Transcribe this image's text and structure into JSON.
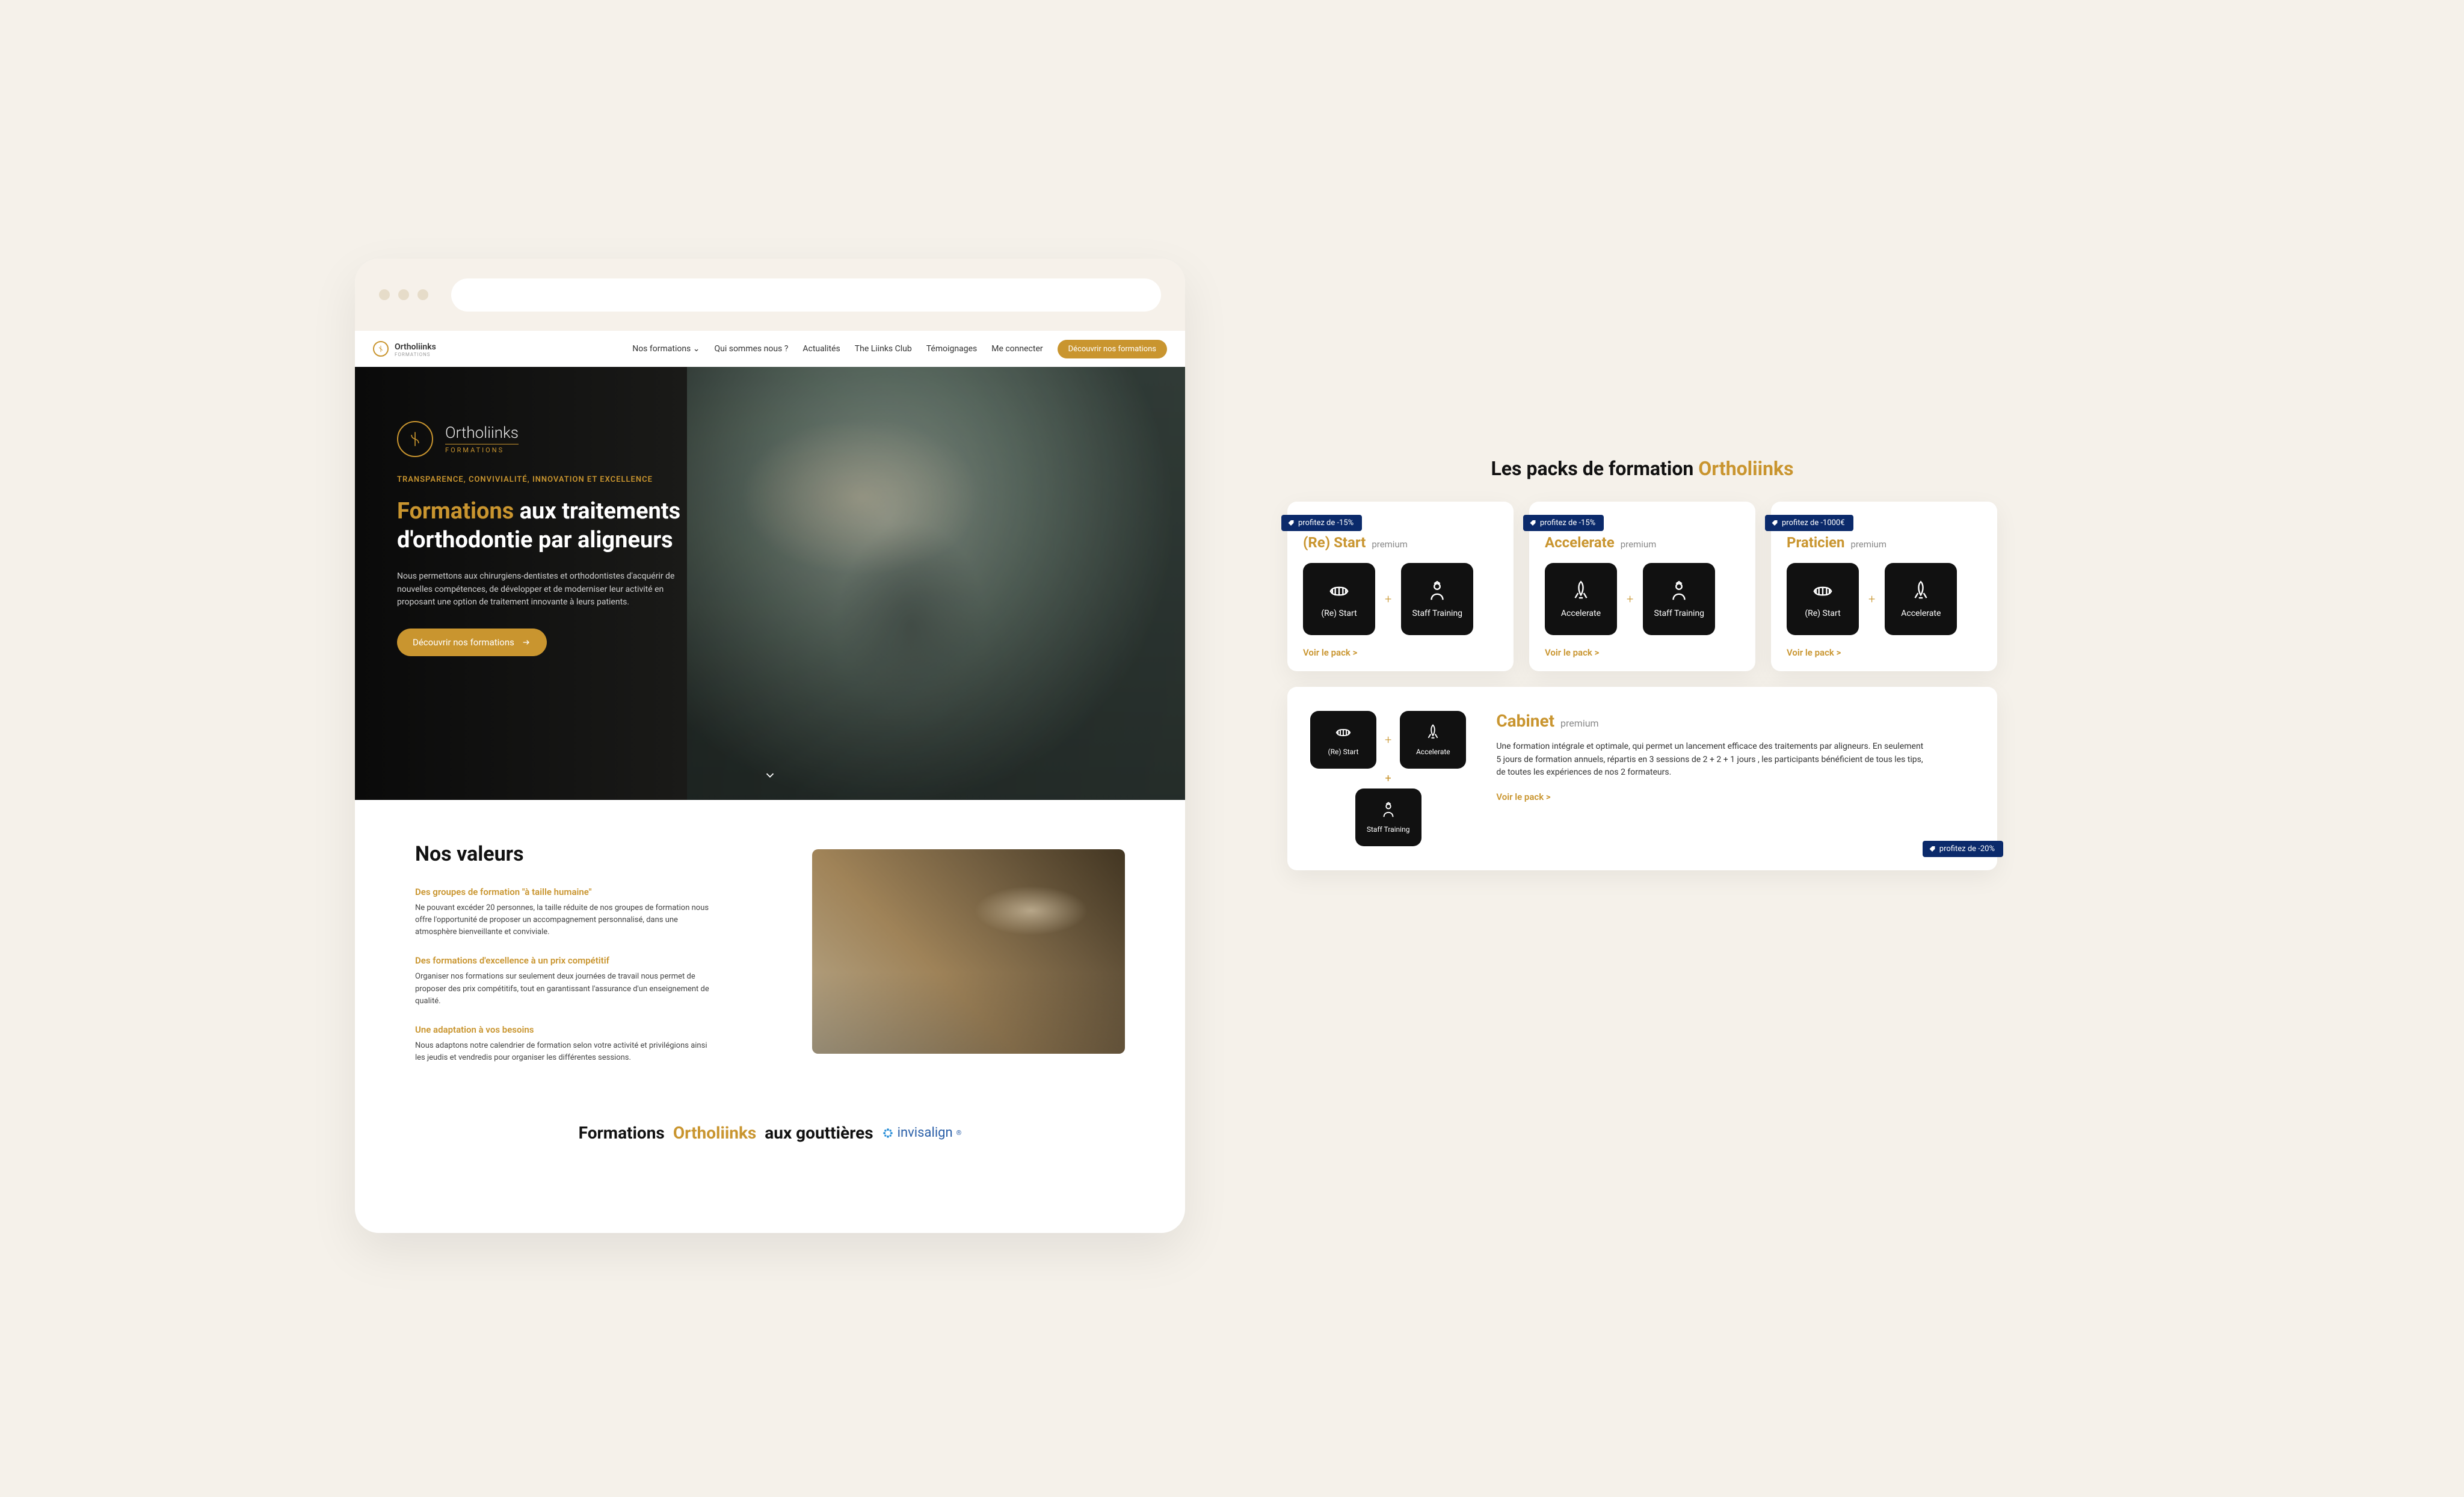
{
  "brand": {
    "name": "Ortholiinks",
    "sub": "FORMATIONS"
  },
  "nav": {
    "items": [
      "Nos formations ⌄",
      "Qui sommes nous ?",
      "Actualités",
      "The Liinks Club",
      "Témoignages",
      "Me connecter"
    ],
    "cta": "Découvrir nos formations"
  },
  "hero": {
    "kicker": "TRANSPARENCE, CONVIVIALITÉ, INNOVATION ET EXCELLENCE",
    "title_accent": "Formations",
    "title_rest": " aux traitements d'orthodontie par aligneurs",
    "desc": "Nous permettons aux chirurgiens-dentistes et orthodontistes d'acquérir de nouvelles compétences, de développer et de moderniser leur activité en proposant une option de traitement innovante à leurs patients.",
    "cta": "Découvrir nos formations"
  },
  "values": {
    "heading": "Nos valeurs",
    "blocks": [
      {
        "h": "Des groupes de formation \"à taille humaine\"",
        "p": "Ne pouvant excéder 20 personnes, la taille réduite de nos groupes de formation nous offre l'opportunité de proposer un accompagnement personnalisé, dans une atmosphère bienveillante et conviviale."
      },
      {
        "h": "Des formations d'excellence à un prix compétitif",
        "p": "Organiser nos formations sur seulement deux journées de travail nous permet de proposer des prix compétitifs, tout en garantissant l'assurance d'un enseignement de qualité."
      },
      {
        "h": "Une adaptation à vos besoins",
        "p": "Nous adaptons notre calendrier de formation selon votre activité et privilégions ainsi les jeudis et vendredis pour organiser les différentes sessions."
      }
    ]
  },
  "formations_line": {
    "pre": "Formations ",
    "accent": "Ortholiinks",
    "post": " aux gouttières",
    "partner": "invisalign"
  },
  "packs": {
    "title_pre": "Les packs de formation ",
    "title_accent": "Ortholiinks",
    "cards": [
      {
        "promo": "profitez de -15%",
        "name": "(Re) Start",
        "sub": "premium",
        "items": [
          "(Re) Start",
          "Staff Training"
        ],
        "link": "Voir le pack  >"
      },
      {
        "promo": "profitez de -15%",
        "name": "Accelerate",
        "sub": "premium",
        "items": [
          "Accelerate",
          "Staff Training"
        ],
        "link": "Voir le pack  >"
      },
      {
        "promo": "profitez de -1000€",
        "name": "Praticien",
        "sub": "premium",
        "items": [
          "(Re) Start",
          "Accelerate"
        ],
        "link": "Voir le pack  >"
      }
    ],
    "cabinet": {
      "name": "Cabinet",
      "sub": "premium",
      "items": [
        "(Re) Start",
        "Accelerate",
        "Staff Training"
      ],
      "desc": "Une formation intégrale et optimale, qui permet un lancement efficace des traitements par aligneurs. En seulement 5 jours de formation annuels, répartis en 3 sessions de 2 + 2 + 1 jours , les participants bénéficient de tous les tips, de toutes les expériences de nos 2 formateurs.",
      "link": "Voir le pack  >",
      "promo": "profitez de -20%"
    }
  }
}
